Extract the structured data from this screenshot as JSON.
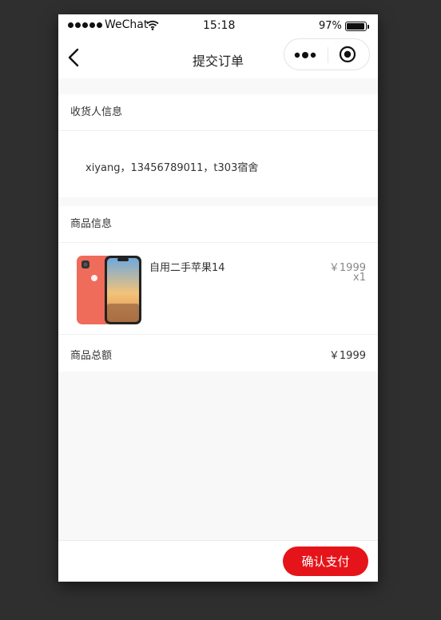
{
  "status_bar": {
    "carrier": "WeChat",
    "time": "15:18",
    "battery_percent": "97%",
    "battery_level": 0.97,
    "icons": [
      "signal-icon",
      "wifi-icon",
      "battery-icon"
    ]
  },
  "nav": {
    "title": "提交订单",
    "icons": [
      "back-arrow-icon",
      "more-dots-icon",
      "close-circle-icon"
    ]
  },
  "receiver": {
    "section_title": "收货人信息",
    "info": "xiyang，13456789011，t303宿舍"
  },
  "goods": {
    "section_title": "商品信息",
    "items": [
      {
        "name": "自用二手苹果14",
        "price": "￥1999",
        "quantity": "x1",
        "image_icon": "iphone-product-image"
      }
    ]
  },
  "total": {
    "label": "商品总额",
    "value": "￥1999"
  },
  "footer": {
    "pay_label": "确认支付",
    "accent_color": "#e5141a"
  }
}
